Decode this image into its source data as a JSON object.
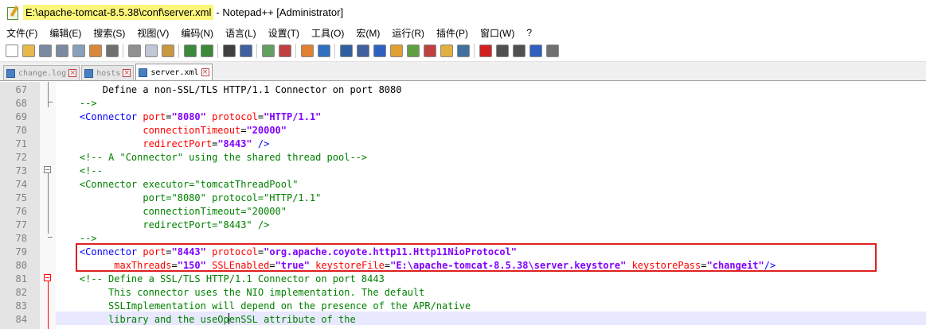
{
  "window": {
    "title_path": "E:\\apache-tomcat-8.5.38\\conf\\server.xml",
    "title_rest": "- Notepad++ [Administrator]"
  },
  "menu": [
    "文件(F)",
    "编辑(E)",
    "搜索(S)",
    "视图(V)",
    "编码(N)",
    "语言(L)",
    "设置(T)",
    "工具(O)",
    "宏(M)",
    "运行(R)",
    "插件(P)",
    "窗口(W)",
    "?"
  ],
  "toolbar_buttons": [
    {
      "icon": "new-file-icon",
      "color": "#ffffff"
    },
    {
      "icon": "open-file-icon",
      "color": "#e8b84a"
    },
    {
      "icon": "save-icon",
      "color": "#7a8aa0"
    },
    {
      "icon": "save-all-icon",
      "color": "#7a8aa0"
    },
    {
      "icon": "close-icon",
      "color": "#8aa0b8"
    },
    {
      "icon": "close-all-icon",
      "color": "#d88a3a"
    },
    {
      "icon": "print-icon",
      "color": "#707070"
    },
    {
      "sep": true
    },
    {
      "icon": "cut-icon",
      "color": "#909090"
    },
    {
      "icon": "copy-icon",
      "color": "#c0c8d8"
    },
    {
      "icon": "paste-icon",
      "color": "#c89840"
    },
    {
      "sep": true
    },
    {
      "icon": "undo-icon",
      "color": "#3a8a3a"
    },
    {
      "icon": "redo-icon",
      "color": "#3a8a3a"
    },
    {
      "sep": true
    },
    {
      "icon": "find-icon",
      "color": "#404040"
    },
    {
      "icon": "replace-icon",
      "color": "#4060a0"
    },
    {
      "sep": true
    },
    {
      "icon": "zoom-in-icon",
      "color": "#60a060"
    },
    {
      "icon": "zoom-out-icon",
      "color": "#c04040"
    },
    {
      "sep": true
    },
    {
      "icon": "sync-vertical-icon",
      "color": "#e08030"
    },
    {
      "icon": "sync-horizontal-icon",
      "color": "#3070c0"
    },
    {
      "sep": true
    },
    {
      "icon": "word-wrap-icon",
      "color": "#3060a0"
    },
    {
      "icon": "show-all-chars-icon",
      "color": "#4060a0"
    },
    {
      "icon": "indent-guide-icon",
      "color": "#3060c0"
    },
    {
      "icon": "udl-icon",
      "color": "#e0a030"
    },
    {
      "icon": "doc-map-icon",
      "color": "#60a040"
    },
    {
      "icon": "function-list-icon",
      "color": "#c04040"
    },
    {
      "icon": "folder-workspace-icon",
      "color": "#e0b040"
    },
    {
      "icon": "monitoring-icon",
      "color": "#4070a0"
    },
    {
      "sep": true
    },
    {
      "icon": "record-macro-icon",
      "color": "#d02020"
    },
    {
      "icon": "stop-record-icon",
      "color": "#505050"
    },
    {
      "icon": "play-macro-icon",
      "color": "#505050"
    },
    {
      "icon": "play-multiple-icon",
      "color": "#3060c0"
    },
    {
      "icon": "save-macro-icon",
      "color": "#707070"
    }
  ],
  "tabs": [
    {
      "label": "change.log",
      "active": false
    },
    {
      "label": "hosts",
      "active": false
    },
    {
      "label": "server.xml",
      "active": true
    }
  ],
  "lines": [
    {
      "n": "67",
      "segs": [
        [
          "txt",
          "        Define a non-SSL/TLS HTTP/1.1 Connector on port 8080"
        ]
      ]
    },
    {
      "n": "68",
      "segs": [
        [
          "cmt",
          "    -->"
        ]
      ]
    },
    {
      "n": "69",
      "segs": [
        [
          "tag",
          "    <Connector "
        ],
        [
          "attr",
          "port"
        ],
        [
          "txt",
          "="
        ],
        [
          "val",
          "\"8080\""
        ],
        [
          "txt",
          " "
        ],
        [
          "attr",
          "protocol"
        ],
        [
          "txt",
          "="
        ],
        [
          "val",
          "\"HTTP/1.1\""
        ]
      ]
    },
    {
      "n": "70",
      "segs": [
        [
          "txt",
          "               "
        ],
        [
          "attr",
          "connectionTimeout"
        ],
        [
          "txt",
          "="
        ],
        [
          "val",
          "\"20000\""
        ]
      ]
    },
    {
      "n": "71",
      "segs": [
        [
          "txt",
          "               "
        ],
        [
          "attr",
          "redirectPort"
        ],
        [
          "txt",
          "="
        ],
        [
          "val",
          "\"8443\""
        ],
        [
          "tag",
          " />"
        ]
      ]
    },
    {
      "n": "72",
      "segs": [
        [
          "cmt",
          "    <!-- A \"Connector\" using the shared thread pool-->"
        ]
      ]
    },
    {
      "n": "73",
      "segs": [
        [
          "cmt",
          "    <!--"
        ]
      ]
    },
    {
      "n": "74",
      "segs": [
        [
          "cmt",
          "    <Connector executor=\"tomcatThreadPool\""
        ]
      ]
    },
    {
      "n": "75",
      "segs": [
        [
          "cmt",
          "               port=\"8080\" protocol=\"HTTP/1.1\""
        ]
      ]
    },
    {
      "n": "76",
      "segs": [
        [
          "cmt",
          "               connectionTimeout=\"20000\""
        ]
      ]
    },
    {
      "n": "77",
      "segs": [
        [
          "cmt",
          "               redirectPort=\"8443\" />"
        ]
      ]
    },
    {
      "n": "78",
      "segs": [
        [
          "cmt",
          "    -->"
        ]
      ]
    },
    {
      "n": "79",
      "segs": [
        [
          "tag",
          "    <Connector "
        ],
        [
          "attr",
          "port"
        ],
        [
          "txt",
          "="
        ],
        [
          "val",
          "\"8443\""
        ],
        [
          "txt",
          " "
        ],
        [
          "attr",
          "protocol"
        ],
        [
          "txt",
          "="
        ],
        [
          "val",
          "\"org.apache.coyote.http11.Http11NioProtocol\""
        ]
      ]
    },
    {
      "n": "80",
      "segs": [
        [
          "txt",
          "          "
        ],
        [
          "attr",
          "maxThreads"
        ],
        [
          "txt",
          "="
        ],
        [
          "val",
          "\"150\""
        ],
        [
          "txt",
          " "
        ],
        [
          "attr",
          "SSLEnabled"
        ],
        [
          "txt",
          "="
        ],
        [
          "val",
          "\"true\""
        ],
        [
          "txt",
          " "
        ],
        [
          "attr",
          "keystoreFile"
        ],
        [
          "txt",
          "="
        ],
        [
          "val",
          "\"E:\\apache-tomcat-8.5.38\\server.keystore\""
        ],
        [
          "txt",
          " "
        ],
        [
          "attr",
          "keystorePass"
        ],
        [
          "txt",
          "="
        ],
        [
          "val",
          "\"changeit\""
        ],
        [
          "tag",
          "/>"
        ]
      ]
    },
    {
      "n": "81",
      "segs": [
        [
          "cmt",
          "    <!-- Define a SSL/TLS HTTP/1.1 Connector on port 8443"
        ]
      ]
    },
    {
      "n": "82",
      "segs": [
        [
          "cmt",
          "         This connector uses the NIO implementation. The default"
        ]
      ]
    },
    {
      "n": "83",
      "segs": [
        [
          "cmt",
          "         SSLImplementation will depend on the presence of the APR/native"
        ]
      ]
    },
    {
      "n": "84",
      "segs": [
        [
          "cmt",
          "         library and the useOpenSSL attribute of the"
        ]
      ]
    }
  ]
}
